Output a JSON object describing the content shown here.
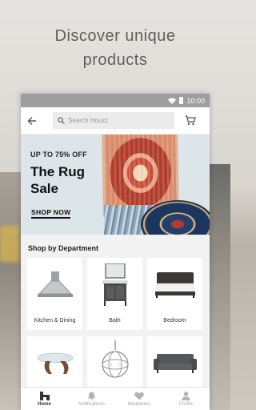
{
  "headline": {
    "line1": "Discover unique",
    "line2": "products"
  },
  "status_bar": {
    "time": "10:00"
  },
  "app_bar": {
    "search_placeholder": "Search Houzz"
  },
  "banner": {
    "promo": "UP TO 75% OFF",
    "title": "The Rug Sale",
    "cta": "SHOP NOW"
  },
  "departments": {
    "title": "Shop by Department",
    "items": [
      {
        "label": "Kitchen & Dining",
        "icon": "range-hood"
      },
      {
        "label": "Bath",
        "icon": "vanity"
      },
      {
        "label": "Bedroom",
        "icon": "bed"
      },
      {
        "label": "",
        "icon": "coffee-table"
      },
      {
        "label": "",
        "icon": "chandelier"
      },
      {
        "label": "",
        "icon": "sofa"
      }
    ]
  },
  "bottom_nav": [
    {
      "label": "Home",
      "icon": "home-icon",
      "active": true
    },
    {
      "label": "Notifications",
      "icon": "bell-icon",
      "active": false
    },
    {
      "label": "Ideabooks",
      "icon": "heart-icon",
      "active": false
    },
    {
      "label": "Profile",
      "icon": "person-icon",
      "active": false
    }
  ],
  "colors": {
    "accent": "#4caf50",
    "status_bar": "#9e9e9e",
    "text_dark": "#222222"
  }
}
